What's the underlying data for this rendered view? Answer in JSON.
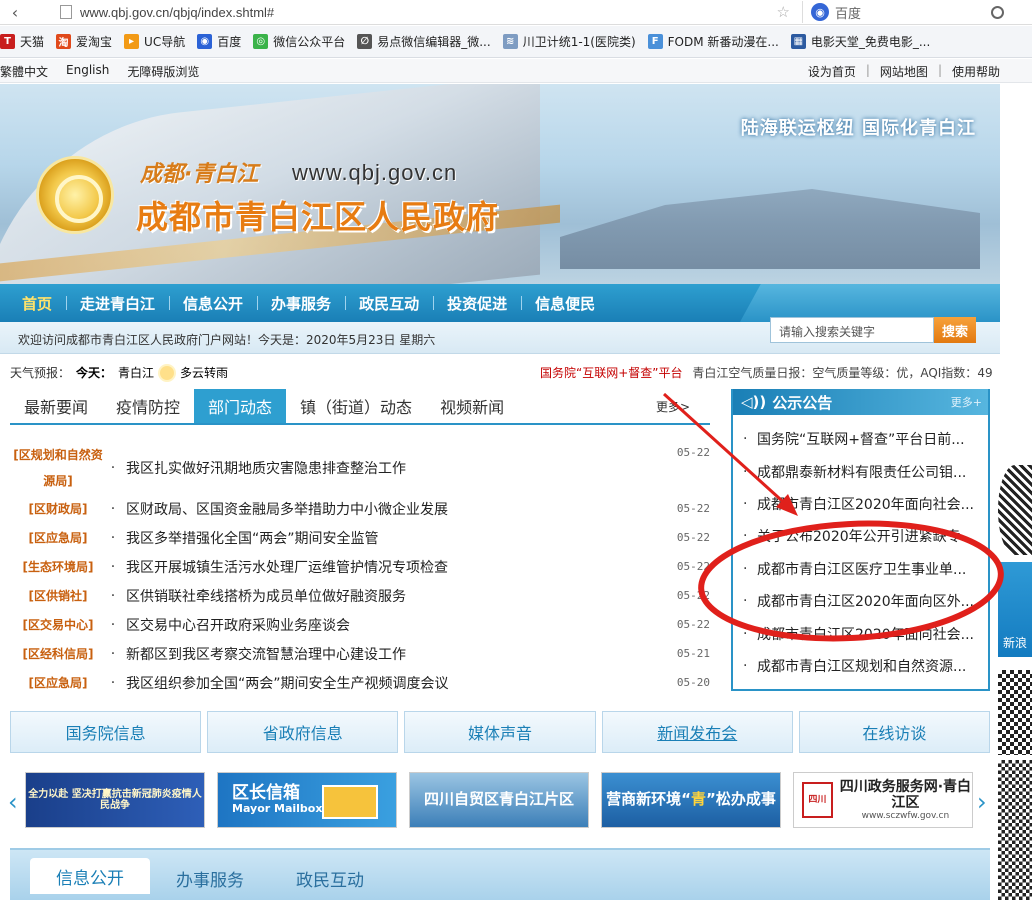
{
  "browser": {
    "url": "www.qbj.gov.cn/qbjq/index.shtml#",
    "search_engine": "百度",
    "bookmarks": [
      "天猫",
      "爱淘宝",
      "UC导航",
      "百度",
      "微信公众平台",
      "易点微信编辑器_微...",
      "川卫计统1-1(医院类)",
      "FODM 新番动漫在...",
      "电影天堂_免费电影_..."
    ]
  },
  "util": {
    "left": [
      "繁體中文",
      "English",
      "无障碍版浏览"
    ],
    "right": [
      "设为首页",
      "网站地图",
      "使用帮助"
    ]
  },
  "banner": {
    "slogan": "成都·青白江",
    "url": "www.qbj.gov.cn",
    "title": "成都市青白江区人民政府",
    "motto": "陆海联运枢纽 国际化青白江"
  },
  "nav": {
    "items": [
      "首页",
      "走进青白江",
      "信息公开",
      "办事服务",
      "政民互动",
      "投资促进",
      "信息便民"
    ],
    "active_index": 0
  },
  "welcome": "欢迎访问成都市青白江区人民政府门户网站！今天是：2020年5月23日 星期六",
  "search": {
    "placeholder": "请输入搜索关键字",
    "button": "搜索"
  },
  "weather": {
    "label": "天气预报：",
    "today": "今天：",
    "place": "青白江",
    "condition": "多云转雨"
  },
  "notice_top": {
    "red": "国务院“互联网+督查”平台",
    "grey": "青白江空气质量日报：空气质量等级：优，AQI指数：49"
  },
  "news_tabs": {
    "tabs": [
      "最新要闻",
      "疫情防控",
      "部门动态",
      "镇（街道）动态",
      "视频新闻"
    ],
    "active_index": 2,
    "more": "更多>"
  },
  "news": [
    {
      "cat": "[区规划和自然资源局]",
      "title": "我区扎实做好汛期地质灾害隐患排查整治工作",
      "date": "05-22"
    },
    {
      "cat": "[区财政局]",
      "title": "区财政局、区国资金融局多举措助力中小微企业发展",
      "date": "05-22"
    },
    {
      "cat": "[区应急局]",
      "title": "我区多举措强化全国“两会”期间安全监管",
      "date": "05-22"
    },
    {
      "cat": "[生态环境局]",
      "title": "我区开展城镇生活污水处理厂运维管护情况专项检查",
      "date": "05-22"
    },
    {
      "cat": "[区供销社]",
      "title": "区供销联社牵线搭桥为成员单位做好融资服务",
      "date": "05-22"
    },
    {
      "cat": "[区交易中心]",
      "title": "区交易中心召开政府采购业务座谈会",
      "date": "05-22"
    },
    {
      "cat": "[区经科信局]",
      "title": "新都区到我区考察交流智慧治理中心建设工作",
      "date": "05-21"
    },
    {
      "cat": "[区应急局]",
      "title": "我区组织参加全国“两会”期间安全生产视频调度会议",
      "date": "05-20"
    }
  ],
  "announcements": {
    "title": "公示公告",
    "more": "更多+",
    "items": [
      "国务院“互联网+督查”平台日前...",
      "成都鼎泰新材料有限责任公司钼...",
      "成都市青白江区2020年面向社会...",
      "关于公布2020年公开引进紧缺专...",
      "成都市青白江区医疗卫生事业单...",
      "成都市青白江区2020年面向区外...",
      "成都市青白江区2020年面向社会...",
      "成都市青白江区规划和自然资源..."
    ]
  },
  "side_widget": {
    "label": "新浪"
  },
  "quick_links": [
    "国务院信息",
    "省政府信息",
    "媒体声音",
    "新闻发布会",
    "在线访谈"
  ],
  "carousel": {
    "slide1": "全力以赴 坚决打赢抗击新冠肺炎疫情人民战争",
    "slide2_title": "区长信箱",
    "slide2_sub": "Mayor Mailbox",
    "slide3": "四川自贸区青白江片区",
    "slide4_a": "营商新环境“",
    "slide4_q": "青",
    "slide4_b": "”松办成事",
    "slide5": "四川政务服务网·青白江区",
    "slide5_seal": "四川",
    "slide5_url": "www.sczwfw.gov.cn"
  },
  "bottom_tabs": {
    "tabs": [
      "信息公开",
      "办事服务",
      "政民互动"
    ],
    "active_index": 0
  },
  "colors": {
    "brand_blue": "#2a93c7",
    "accent_orange": "#e77c12",
    "annotation_red": "#e0201b"
  }
}
